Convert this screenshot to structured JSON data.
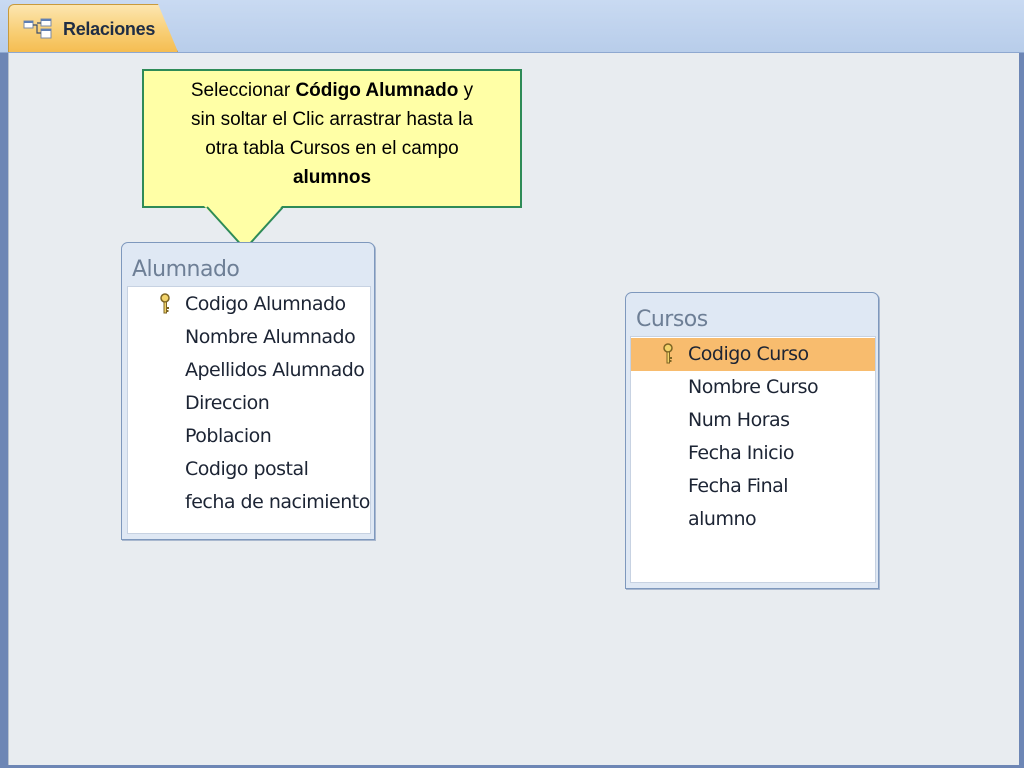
{
  "tab": {
    "label": "Relaciones",
    "icon": "relationships-icon"
  },
  "callout": {
    "line1_pre": "Seleccionar ",
    "line1_bold": "Código Alumnado",
    "line1_post": " y",
    "line2": "sin soltar el Clic arrastrar hasta la",
    "line3": "otra tabla Cursos en el campo",
    "line4_bold": "alumnos"
  },
  "tables": {
    "alumnado": {
      "title": "Alumnado",
      "fields": [
        "Codigo Alumnado",
        "Nombre Alumnado",
        "Apellidos Alumnado",
        "Direccion",
        "Poblacion",
        "Codigo postal",
        "fecha de nacimiento"
      ],
      "primary_key": "Codigo Alumnado"
    },
    "cursos": {
      "title": "Cursos",
      "fields": [
        "Codigo Curso",
        "Nombre Curso",
        "Num Horas",
        "Fecha Inicio",
        "Fecha Final",
        "alumno"
      ],
      "primary_key": "Codigo Curso",
      "selected": "Codigo Curso"
    }
  },
  "colors": {
    "tab_active": "#f8cd72",
    "selection": "#f8bc6e",
    "callout_bg": "#ffffa6",
    "callout_border": "#2e8b57",
    "canvas_bg": "#e8ecf0"
  }
}
